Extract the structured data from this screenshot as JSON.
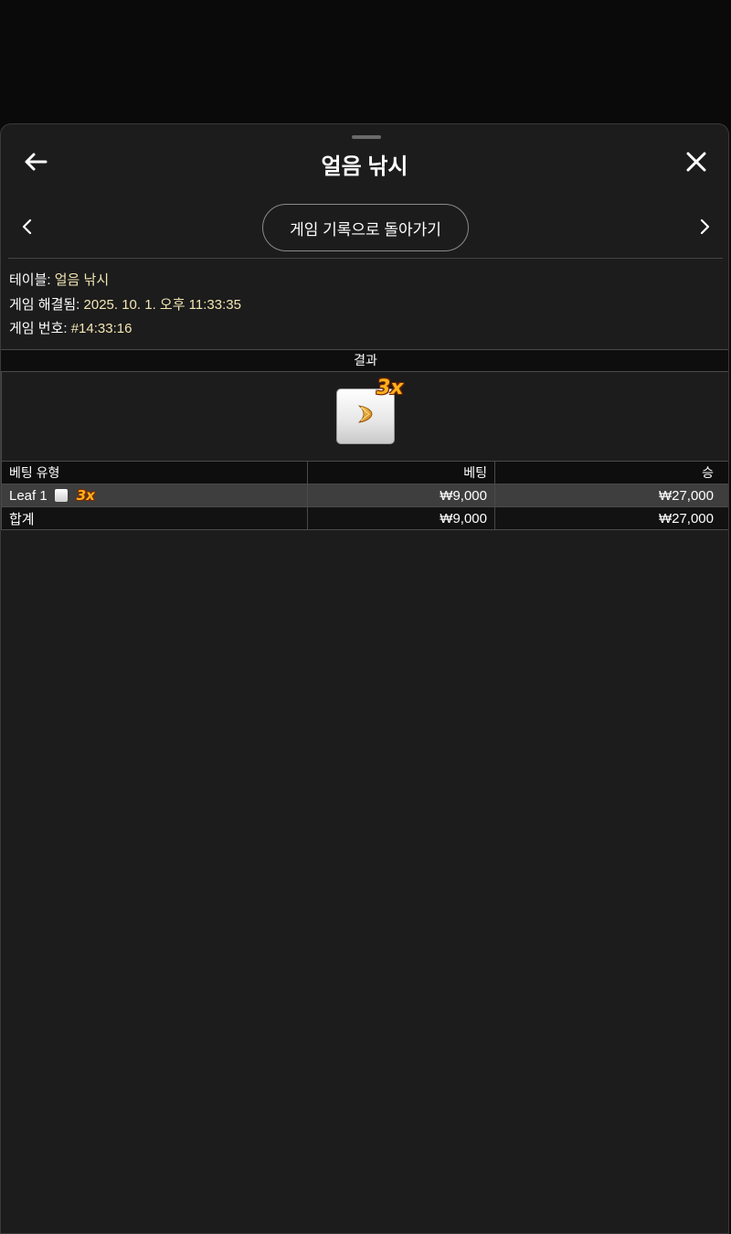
{
  "header": {
    "title": "얼음 낚시",
    "back_icon": "arrow-left-icon",
    "close_icon": "close-icon"
  },
  "nav": {
    "prev_icon": "chevron-left-icon",
    "next_icon": "chevron-right-icon",
    "return_label": "게임 기록으로 돌아가기"
  },
  "info": {
    "table_label": "테이블:",
    "table_value": "얼음 낚시",
    "resolved_label": "게임 해결됨:",
    "resolved_value": "2025. 10. 1. 오후 11:33:35",
    "game_no_label": "게임 번호:",
    "game_no_value": "#14:33:16"
  },
  "result": {
    "header": "결과",
    "multiplier": "3x",
    "symbol_icon": "leaf-icon"
  },
  "bets_table": {
    "columns": [
      "베팅 유형",
      "베팅",
      "승"
    ],
    "rows": [
      {
        "type": "Leaf 1",
        "multiplier": "3x",
        "bet": "₩9,000",
        "win": "₩27,000"
      }
    ],
    "total": {
      "label": "합계",
      "bet": "₩9,000",
      "win": "₩27,000"
    }
  },
  "colors": {
    "page_bg": "#0a0a0a",
    "sheet_bg": "#1c1c1c",
    "accent_value": "#f3e6b3",
    "multiplier": "#ffb21a",
    "highlight_row": "#3e3e3e"
  }
}
